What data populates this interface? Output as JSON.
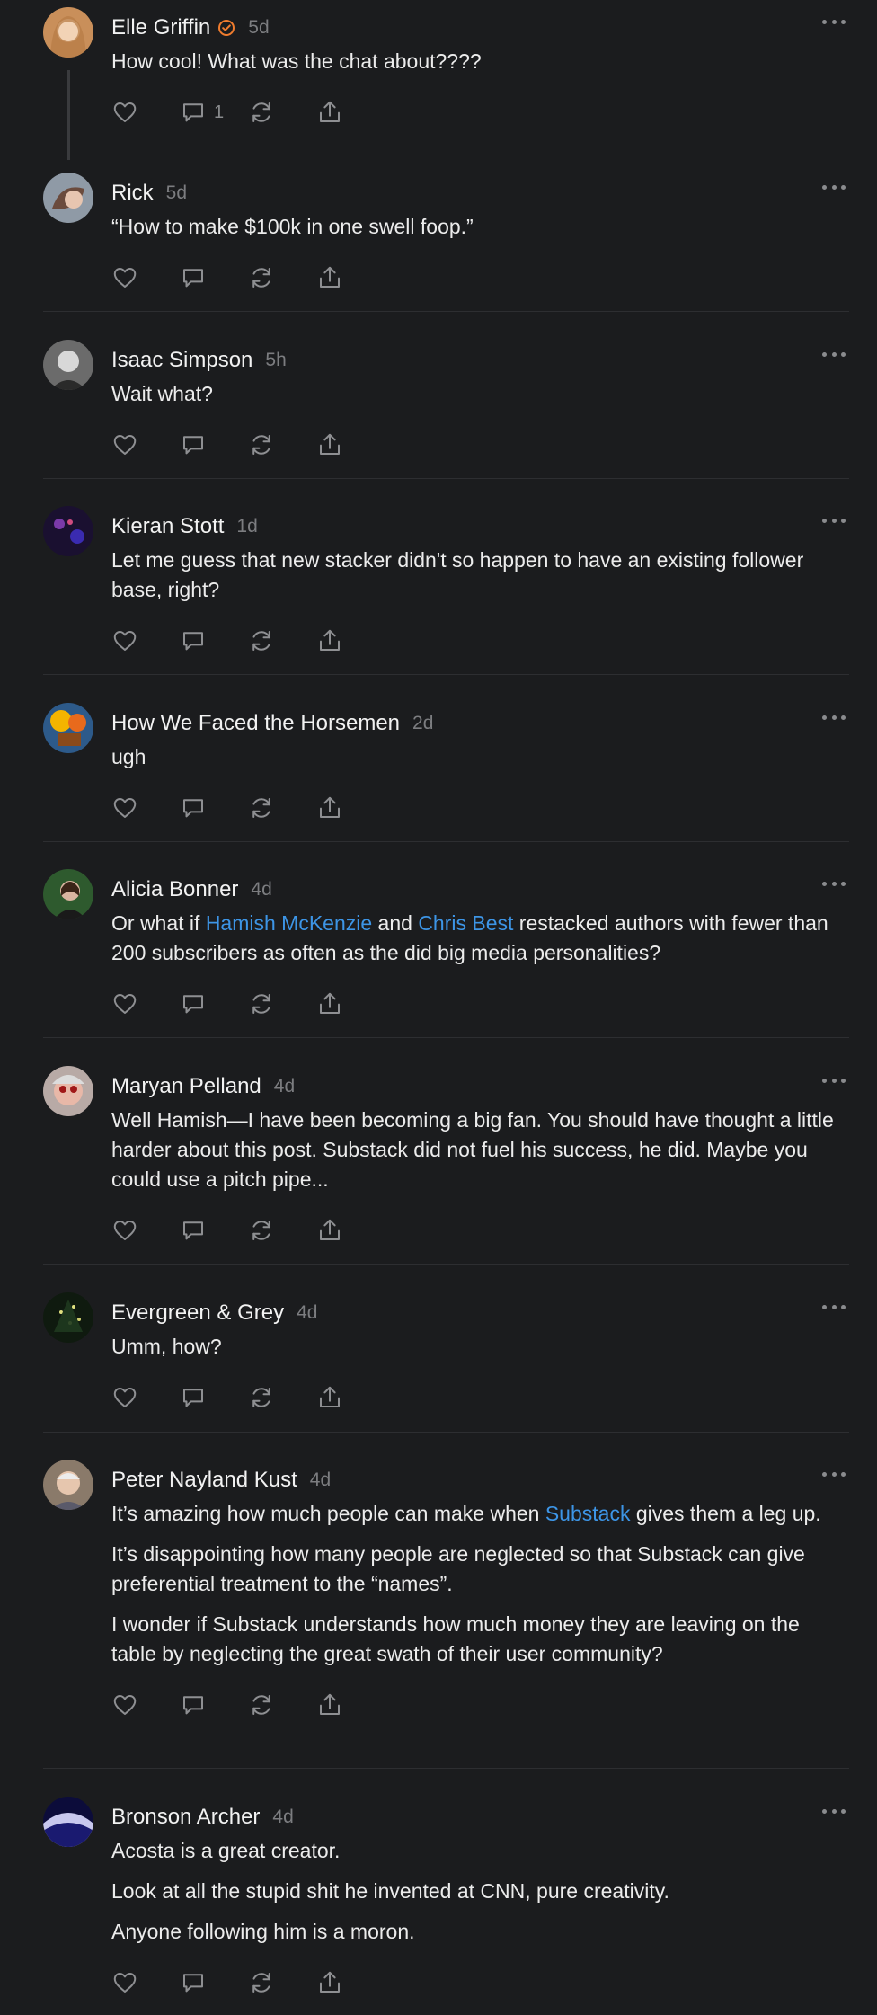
{
  "colors": {
    "background": "#1b1c1e",
    "link": "#3d95e6",
    "badge": "#f07c2e"
  },
  "comments": [
    {
      "author": "Elle Griffin",
      "time": "5d",
      "verified_badge": true,
      "comment_count": "1",
      "paragraphs": [
        [
          {
            "t": "How cool! What was the chat about????"
          }
        ]
      ]
    },
    {
      "author": "Rick",
      "time": "5d",
      "paragraphs": [
        [
          {
            "t": "“How to make $100k in one swell foop.”"
          }
        ]
      ]
    },
    {
      "author": "Isaac Simpson",
      "time": "5h",
      "paragraphs": [
        [
          {
            "t": "Wait what?"
          }
        ]
      ]
    },
    {
      "author": "Kieran Stott",
      "time": "1d",
      "paragraphs": [
        [
          {
            "t": "Let me guess that new stacker didn't so happen to have an existing follower base, right?"
          }
        ]
      ]
    },
    {
      "author": "How We Faced the Horsemen",
      "time": "2d",
      "paragraphs": [
        [
          {
            "t": "ugh"
          }
        ]
      ]
    },
    {
      "author": "Alicia Bonner",
      "time": "4d",
      "paragraphs": [
        [
          {
            "t": "Or what if "
          },
          {
            "t": "Hamish McKenzie",
            "link": true
          },
          {
            "t": " and "
          },
          {
            "t": "Chris Best",
            "link": true
          },
          {
            "t": " restacked authors with fewer than 200 subscribers as often as the did big media personalities?"
          }
        ]
      ]
    },
    {
      "author": "Maryan Pelland",
      "time": "4d",
      "paragraphs": [
        [
          {
            "t": "Well Hamish—I have been becoming a big fan. You should have thought a little harder about this post. Substack did not fuel his success, he did. Maybe you could use a pitch pipe..."
          }
        ]
      ]
    },
    {
      "author": "Evergreen & Grey",
      "time": "4d",
      "paragraphs": [
        [
          {
            "t": "Umm, how?"
          }
        ]
      ]
    },
    {
      "author": "Peter Nayland Kust",
      "time": "4d",
      "paragraphs": [
        [
          {
            "t": "It’s amazing how much people can make when "
          },
          {
            "t": "Substack",
            "link": true
          },
          {
            "t": " gives them a leg up."
          }
        ],
        [
          {
            "t": "It’s disappointing how many people are neglected so that Substack can give preferential treatment to the “names”."
          }
        ],
        [
          {
            "t": "I wonder if Substack understands how much money they are leaving on the table by neglecting the great swath of their user community?"
          }
        ]
      ]
    },
    {
      "author": "Bronson Archer",
      "time": "4d",
      "paragraphs": [
        [
          {
            "t": "Acosta is a great creator."
          }
        ],
        [
          {
            "t": "Look at all the stupid shit he invented at CNN, pure creativity."
          }
        ],
        [
          {
            "t": "Anyone following him is a moron."
          }
        ]
      ]
    }
  ]
}
